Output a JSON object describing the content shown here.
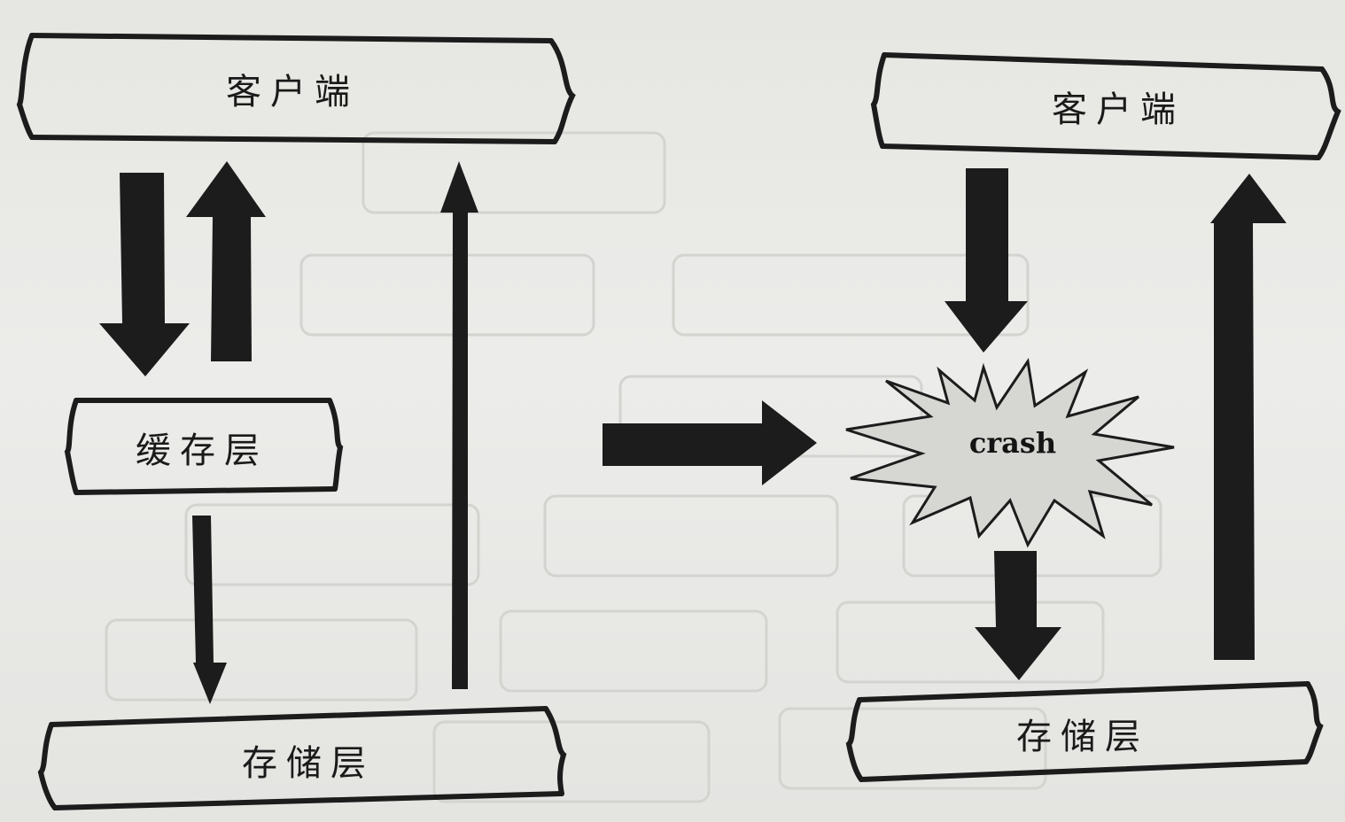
{
  "left": {
    "client_label": "客户端",
    "cache_label": "缓存层",
    "storage_label": "存储层"
  },
  "right": {
    "client_label": "客户端",
    "crash_label": "crash",
    "storage_label": "存储层"
  },
  "colors": {
    "ink": "#1c1c1c",
    "burst_fill": "#d6d6d3",
    "paper": "#e9e9e6"
  }
}
